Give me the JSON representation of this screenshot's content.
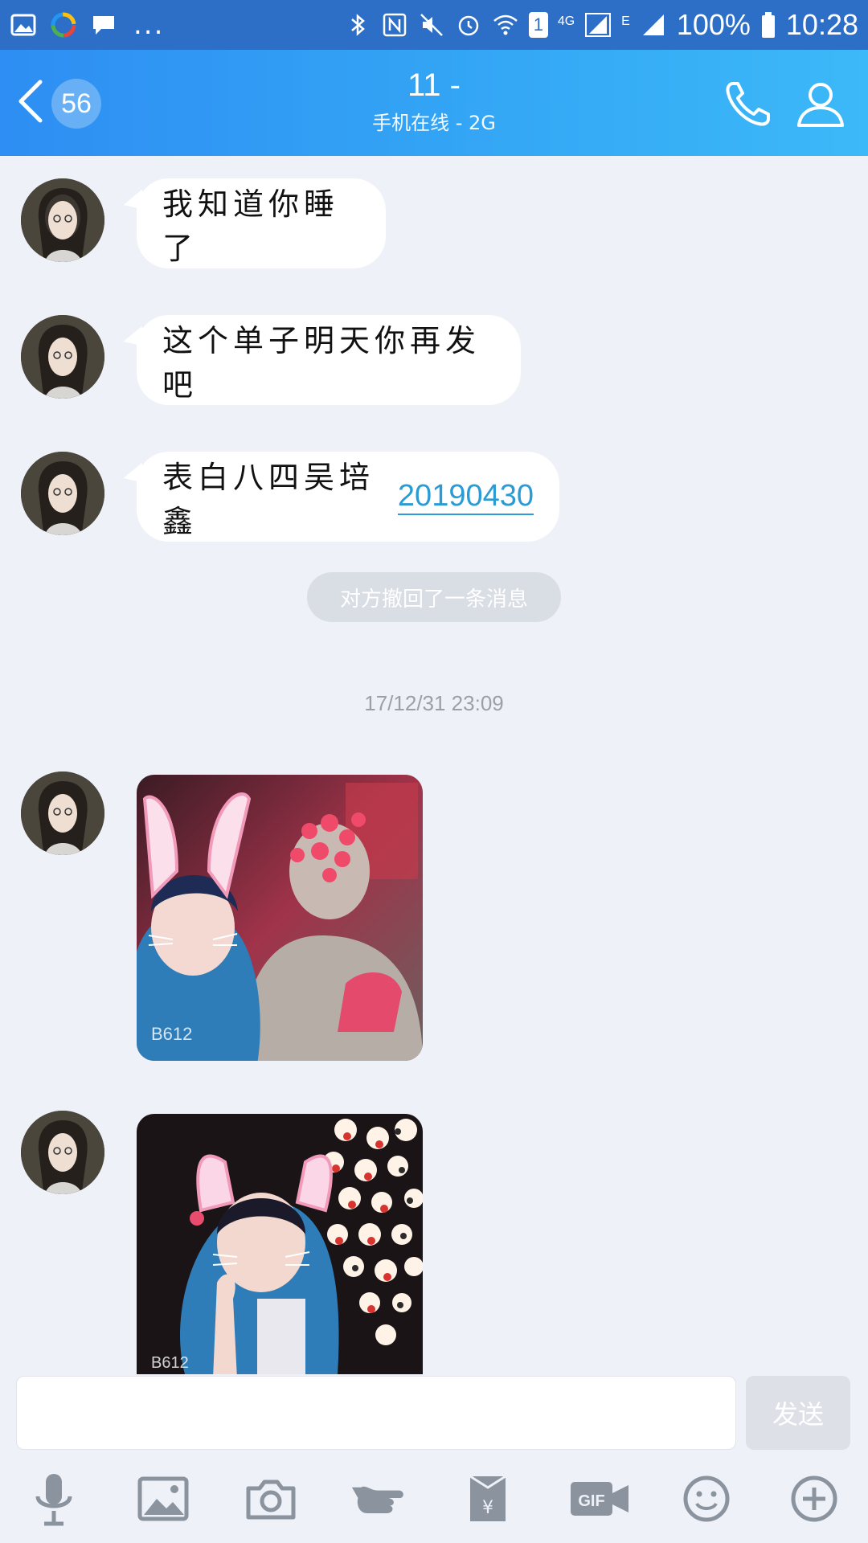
{
  "status_bar": {
    "dots": "...",
    "sim_badge": "1",
    "network_4g": "4G",
    "network_e": "E",
    "battery": "100%",
    "time": "10:28"
  },
  "header": {
    "unread_count": "56",
    "title": "11 -",
    "subtitle": "手机在线 - 2G"
  },
  "messages": [
    {
      "text": "我知道你睡了"
    },
    {
      "text": "这个单子明天你再发吧"
    },
    {
      "text": "表白八四吴培鑫",
      "link": "20190430"
    }
  ],
  "system": {
    "recalled": "对方撤回了一条消息",
    "timestamp": "17/12/31 23:09"
  },
  "photos": [
    {
      "watermark": "B612"
    },
    {
      "watermark": "B612"
    }
  ],
  "input": {
    "placeholder": "",
    "send_label": "发送",
    "gif_label": "GIF"
  },
  "colors": {
    "header_start": "#2e8ef3",
    "header_end": "#3cb9f8",
    "link": "#2a9bd4",
    "background": "#eef1f7"
  }
}
